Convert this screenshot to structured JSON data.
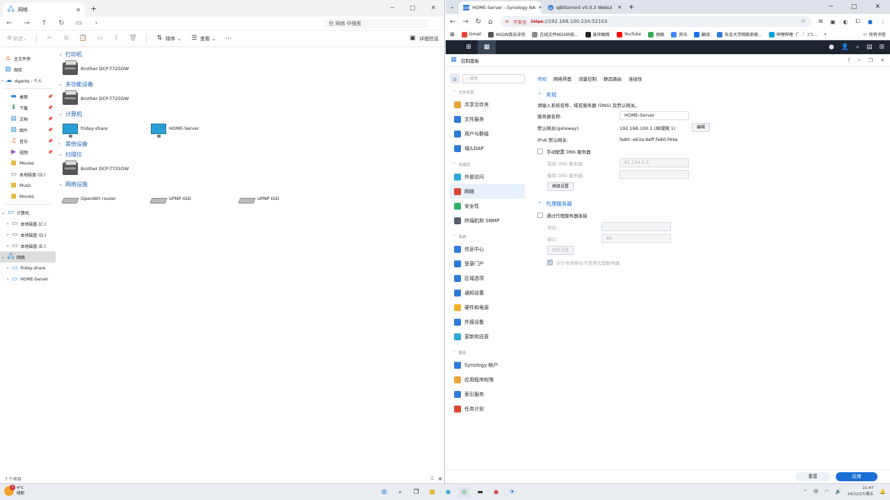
{
  "explorer": {
    "tab_title": "网络",
    "search_placeholder": "在 网络 中搜索",
    "cmd": {
      "new": "新建",
      "sort": "排序",
      "view": "查看",
      "details": "详细信息"
    },
    "nav": [
      {
        "label": "主文件夹"
      },
      {
        "label": "图库"
      },
      {
        "label": "Agents - 个人"
      },
      {
        "label": "桌面"
      },
      {
        "label": "下载"
      },
      {
        "label": "文档"
      },
      {
        "label": "图片"
      },
      {
        "label": "音乐"
      },
      {
        "label": "视频"
      },
      {
        "label": "Movies"
      },
      {
        "label": "本地磁盘 (D:)"
      },
      {
        "label": "Music"
      },
      {
        "label": "Movies"
      },
      {
        "label": "计算机"
      },
      {
        "label": "本地磁盘 (C:)"
      },
      {
        "label": "本地磁盘 (D:)"
      },
      {
        "label": "本地磁盘 (E:)"
      },
      {
        "label": "网络"
      },
      {
        "label": "friday-share"
      },
      {
        "label": "HOME-Server"
      }
    ],
    "groups": [
      {
        "title": "打印机",
        "items": [
          "Brother DCP-T725DW"
        ]
      },
      {
        "title": "多功能设备",
        "items": [
          "Brother DCP-T725DW"
        ]
      },
      {
        "title": "计算机",
        "items": [
          "friday-share",
          "HOME-Server"
        ]
      },
      {
        "title": "其他设备",
        "items": []
      },
      {
        "title": "扫描仪",
        "items": [
          "Brother DCP-T725DW"
        ]
      },
      {
        "title": "网络设施",
        "items": [
          "OpenWrt router",
          "UPNP IGD",
          "UPNP IGD"
        ]
      }
    ],
    "status": "7 个项目"
  },
  "browser": {
    "tabs": [
      {
        "title": "HOME-Server - Synology NA",
        "icon": "DSM"
      },
      {
        "title": "qBittorrent v5.0.3 WebUI",
        "icon": "qb"
      }
    ],
    "url_warning": "不安全",
    "url_scheme": "https",
    "url_rest": "://192.168.100.234:52103",
    "bookmarks": [
      {
        "label": "Gmail",
        "color": "#ea4335"
      },
      {
        "label": "MSDN我告诉你",
        "color": "#555555"
      },
      {
        "label": "在线文件MD5码校...",
        "color": "#888888"
      },
      {
        "label": "彼岸图网",
        "color": "#222222"
      },
      {
        "label": "YouTube",
        "color": "#ff0000"
      },
      {
        "label": "地图",
        "color": "#34a853"
      },
      {
        "label": "资讯",
        "color": "#4285f4"
      },
      {
        "label": "翻译",
        "color": "#1a73e8"
      },
      {
        "label": "东北大学网络测速...",
        "color": "#2f7bd8"
      },
      {
        "label": "哔哩哔哩（゜-゜)つ...",
        "color": "#00a1d6"
      }
    ],
    "all_bookmarks": "所有书签"
  },
  "control_panel": {
    "title": "控制面板",
    "search_placeholder": "搜索",
    "sections": [
      {
        "title": "文件共享",
        "items": [
          {
            "label": "共享文件夹",
            "color": "#e8a33c"
          },
          {
            "label": "文件服务",
            "color": "#2f7bd8"
          },
          {
            "label": "用户与群组",
            "color": "#2f7bd8"
          },
          {
            "label": "域/LDAP",
            "color": "#2f7bd8"
          }
        ]
      },
      {
        "title": "连接性",
        "items": [
          {
            "label": "外部访问",
            "color": "#2fa7d8"
          },
          {
            "label": "网络",
            "color": "#d8452f"
          },
          {
            "label": "安全性",
            "color": "#2fb36a"
          },
          {
            "label": "终端机和 SNMP",
            "color": "#555f6d"
          }
        ]
      },
      {
        "title": "系统",
        "items": [
          {
            "label": "信息中心",
            "color": "#2f7bd8"
          },
          {
            "label": "登录门户",
            "color": "#2f7bd8"
          },
          {
            "label": "区域选项",
            "color": "#2f7bd8"
          },
          {
            "label": "通知设置",
            "color": "#2f7bd8"
          },
          {
            "label": "硬件和电源",
            "color": "#f0b22c"
          },
          {
            "label": "外接设备",
            "color": "#2f7bd8"
          },
          {
            "label": "更新和还原",
            "color": "#2fa7d8"
          }
        ]
      },
      {
        "title": "服务",
        "items": [
          {
            "label": "Synology 帐户",
            "color": "#2f7bd8"
          },
          {
            "label": "应用程序权限",
            "color": "#e8a33c"
          },
          {
            "label": "索引服务",
            "color": "#2f7bd8"
          },
          {
            "label": "任务计划",
            "color": "#d8452f"
          }
        ]
      }
    ],
    "tabs": [
      "常规",
      "网络界面",
      "流量控制",
      "静态路由",
      "连接性"
    ],
    "general": {
      "title": "常规",
      "desc": "请输入系统名称、域名服务器 (DNS) 及默认网关。",
      "server_name_label": "服务器名称:",
      "server_name": "HOME-Server",
      "gateway_label": "默认网关(gateway):",
      "gateway": "192.168.100.1 (局域网 1)",
      "edit": "编辑",
      "ipv6_label": "IPv6 默认网关:",
      "ipv6": "fe80::e63a:6eff:fe60:f44a",
      "manual_dns": "手动配置 DNS 服务器",
      "pref_dns_label": "首选 DNS 服务器:",
      "pref_dns": "61.134.1.5",
      "alt_dns_label": "备用 DNS 服务器:",
      "alt_dns": "",
      "advanced": "高级设置"
    },
    "proxy": {
      "title": "代理服务器",
      "via_proxy": "通过代理服务器连接",
      "addr_label": "地址:",
      "addr": "",
      "port_label": "端口:",
      "port": "80",
      "advanced": "高级设置",
      "bypass": "对于本地地址不使用代理服务器"
    },
    "footer": {
      "reset": "重置",
      "apply": "应用"
    }
  },
  "taskbar": {
    "weather_temp": "4°C",
    "weather_desc": "晴朗",
    "badge": "1",
    "time": "21:47",
    "date": "24/12/27/周五"
  }
}
